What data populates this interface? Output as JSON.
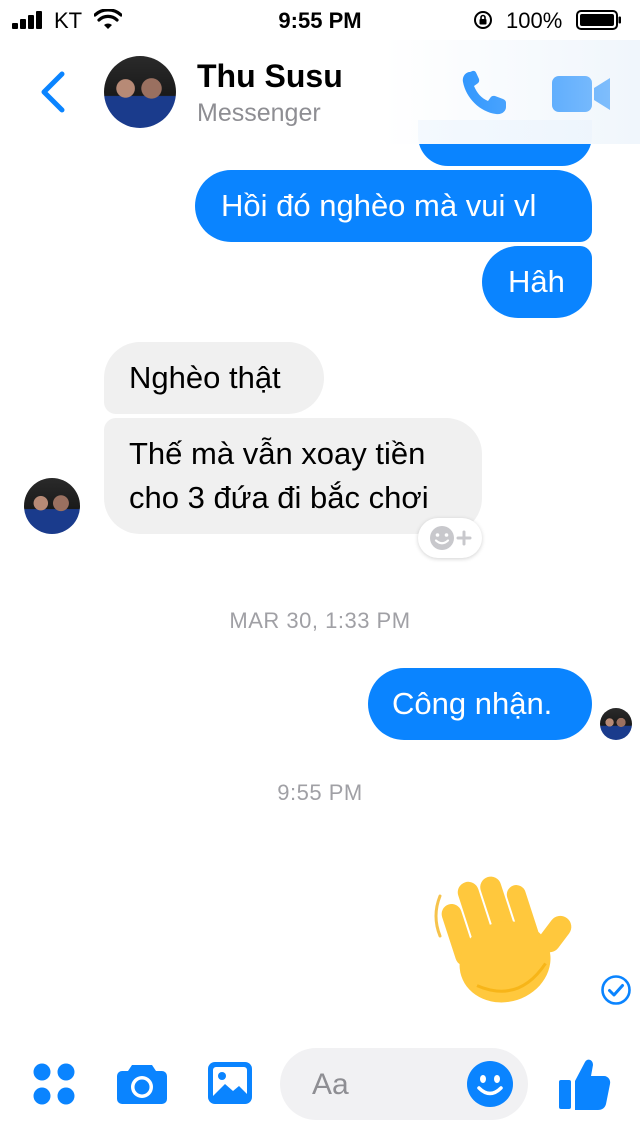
{
  "status_bar": {
    "carrier": "KT",
    "time": "9:55 PM",
    "battery_percent": "100%",
    "icons": [
      "signal-icon",
      "wifi-icon",
      "orientation-lock-icon",
      "battery-icon"
    ]
  },
  "header": {
    "contact_name": "Thu Susu",
    "subtitle": "Messenger",
    "icons": [
      "back-icon",
      "phone-icon",
      "video-icon"
    ]
  },
  "messages": [
    {
      "side": "out",
      "text": "Hồi đó nghèo mà vui vl"
    },
    {
      "side": "out",
      "text": "Hâh"
    },
    {
      "side": "in",
      "text": "Nghèo thật"
    },
    {
      "side": "in",
      "text_lines": [
        "Thế mà vẫn xoay tiền",
        "cho 3 đứa đi bắc chơi"
      ]
    },
    {
      "side": "out",
      "text": "Công nhận."
    },
    {
      "side": "out",
      "emoji": "waving-hand",
      "status": "delivered"
    }
  ],
  "timestamps": {
    "first": "MAR 30, 1:33 PM",
    "second": "9:55 PM"
  },
  "composer": {
    "placeholder": "Aa",
    "value": "",
    "icons": [
      "menu-icon",
      "camera-icon",
      "gallery-icon",
      "emoji-icon",
      "thumbs-up-icon"
    ]
  },
  "colors": {
    "accent": "#0a84ff",
    "incoming_bubble": "#f0f0f0",
    "timestamp": "#a0a0a5",
    "emoji_yellow": "#ffc83d"
  }
}
